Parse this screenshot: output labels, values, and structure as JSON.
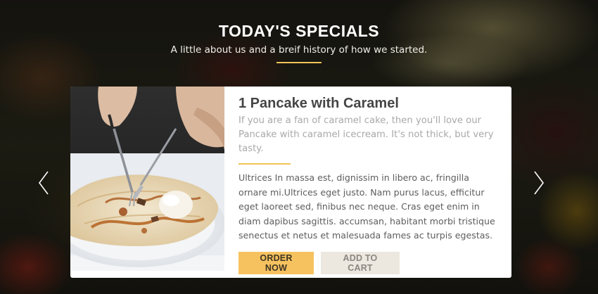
{
  "header": {
    "title": "TODAY'S SPECIALS",
    "subtitle": "A little about us and a breif history of how we started."
  },
  "card": {
    "title": "1 Pancake with Caramel",
    "description": "If you are a fan of caramel cake, then you'll love our Pancake with caramel icecream. It's not thick, but very tasty.",
    "body": "Ultrices In massa est, dignissim in libero ac, fringilla ornare mi.Ultrices eget justo. Nam purus lacus, efficitur eget laoreet sed, finibus nec neque. Cras eget enim in diam dapibus sagittis. accumsan, habitant morbi tristique senectus et netus et malesuada fames ac turpis egestas.",
    "buttons": {
      "order_label": "ORDER NOW",
      "cart_label": "ADD TO CART"
    }
  },
  "nav": {
    "prev_icon": "chevron-left-icon",
    "next_icon": "chevron-right-icon"
  },
  "colors": {
    "accent": "#f0c35a",
    "order_button": "#f6c25f",
    "cart_button": "#ece8e0"
  }
}
